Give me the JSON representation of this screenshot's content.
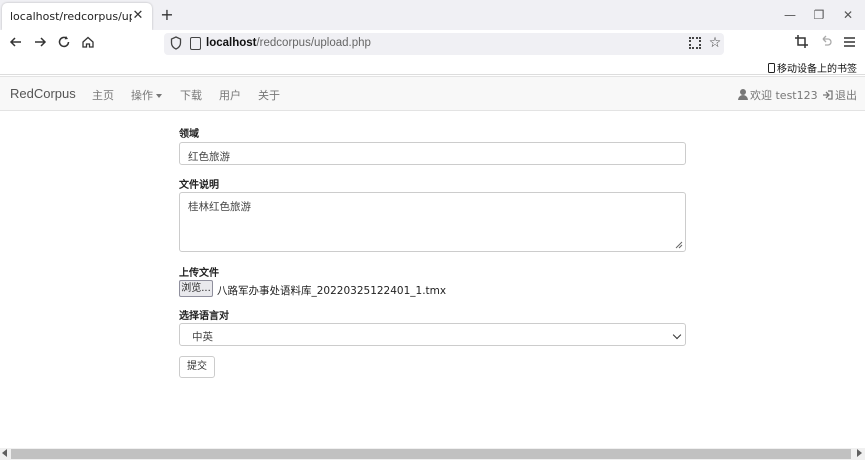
{
  "browser": {
    "tab_title": "localhost/redcorpus/upload.php",
    "tab_close": "✕",
    "new_tab": "+",
    "url_host": "localhost",
    "url_path": "/redcorpus/upload.php",
    "bookmark_mobile": "移动设备上的书签"
  },
  "nav": {
    "brand": "RedCorpus",
    "items": [
      {
        "label": "主页"
      },
      {
        "label": "操作"
      },
      {
        "label": "下载"
      },
      {
        "label": "用户"
      },
      {
        "label": "关于"
      }
    ],
    "welcome": "欢迎 test123",
    "logout": "退出"
  },
  "form": {
    "domain_label": "领域",
    "domain_value": "红色旅游",
    "desc_label": "文件说明",
    "desc_value": "桂林红色旅游",
    "upload_label": "上传文件",
    "browse_label": "浏览...",
    "file_name": "八路军办事处语料库_20220325122401_1.tmx",
    "lang_label": "选择语言对",
    "lang_selected": "中英",
    "submit_label": "提交"
  },
  "icons": [
    "back-icon",
    "forward-icon",
    "reload-icon",
    "home-icon",
    "shield-icon",
    "page-icon",
    "qr-code-icon",
    "bookmark-star-icon",
    "screenshot-icon",
    "undo-icon",
    "menu-icon",
    "user-icon",
    "logout-icon",
    "chevron-down-icon"
  ]
}
